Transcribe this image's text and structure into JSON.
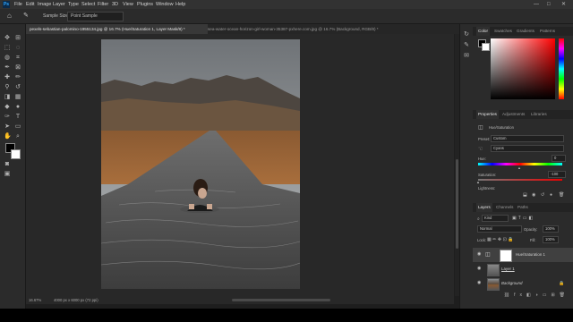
{
  "app": {
    "logo": "Ps"
  },
  "menu": [
    "File",
    "Edit",
    "Image",
    "Layer",
    "Type",
    "Select",
    "Filter",
    "3D",
    "View",
    "Plugins",
    "Window",
    "Help"
  ],
  "window_controls": {
    "minimize": "—",
    "maximize": "□",
    "close": "✕"
  },
  "options_bar": {
    "sample_size_label": "Sample Size:",
    "sample_size_value": "Point Sample"
  },
  "doc_tabs": [
    {
      "title": "pexels-sebastian-palomino-1955134.jpg @ 16.7% (Hue/Saturation 1, Layer Mask/8) *",
      "active": true
    },
    {
      "title": "sea-water-ocean-horizon-girl-woman-35387-pxhere.com.jpg @ 16.7% (Background, RGB/8) *",
      "active": false
    }
  ],
  "status": {
    "zoom": "16.67%",
    "info": "4000 px x 6000 px (72 ppi)"
  },
  "color_panel": {
    "tabs": [
      "Color",
      "Swatches",
      "Gradients",
      "Patterns"
    ],
    "hue_color": "#ff0000"
  },
  "properties": {
    "tabs": [
      "Properties",
      "Adjustments",
      "Libraries"
    ],
    "adjustment": "Hue/Saturation",
    "preset_label": "Preset:",
    "preset_value": "Custom",
    "channel_value": "Cyans",
    "hue_label": "Hue:",
    "hue_value": "0",
    "saturation_label": "Saturation:",
    "saturation_value": "-100",
    "lightness_label": "Lightness:",
    "lightness_value": "0"
  },
  "layers_panel": {
    "tabs": [
      "Layers",
      "Channels",
      "Paths"
    ],
    "kind": "Kind",
    "blend_mode": "Normal",
    "opacity_label": "Opacity:",
    "opacity_value": "100%",
    "lock_label": "Lock:",
    "fill_label": "Fill:",
    "fill_value": "100%",
    "layers": [
      {
        "name": "Hue/Saturation 1",
        "selected": true
      },
      {
        "name": "Layer 1",
        "selected": false
      },
      {
        "name": "Background",
        "selected": false
      }
    ]
  }
}
